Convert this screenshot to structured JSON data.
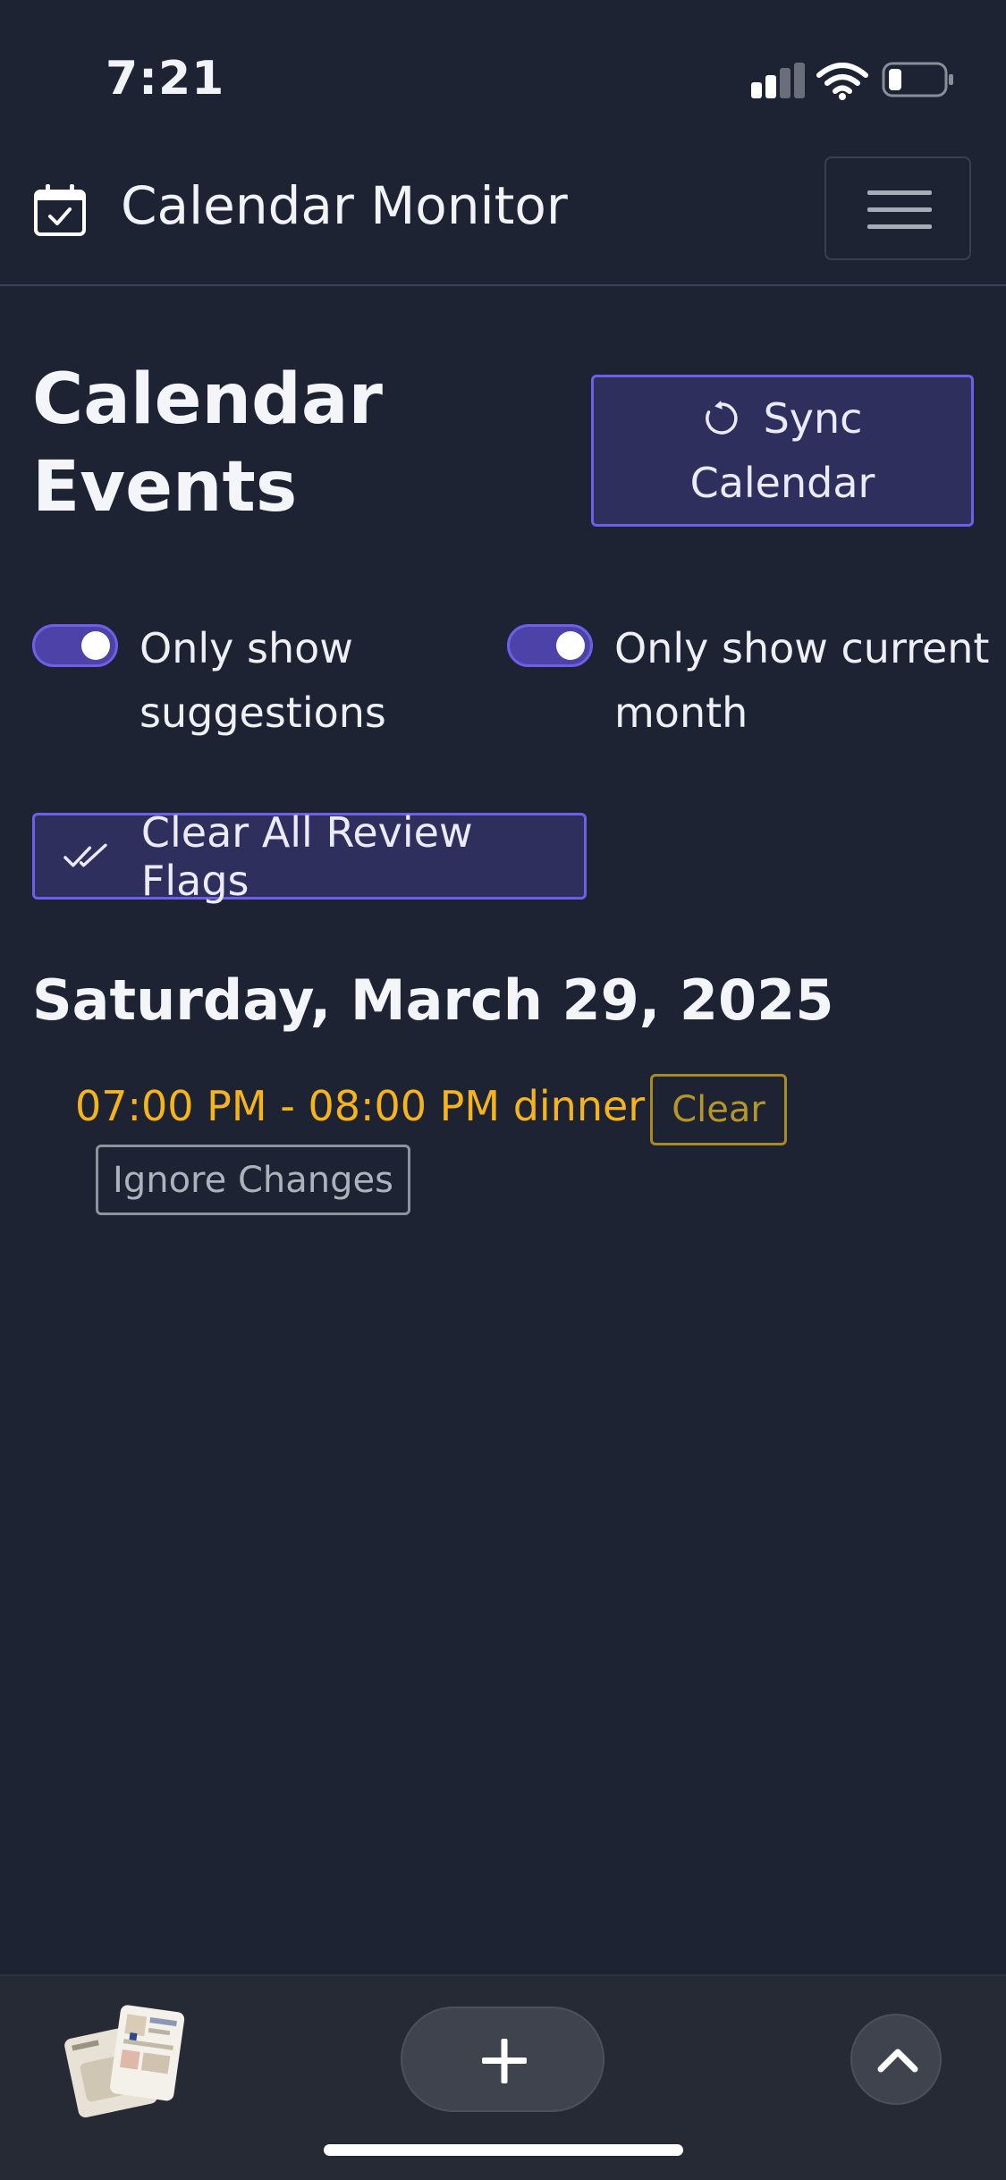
{
  "status_bar": {
    "time": "7:21"
  },
  "header": {
    "title": "Calendar Monitor",
    "icon": "calendar-check-icon",
    "menu_icon": "hamburger-icon"
  },
  "page": {
    "title": "Calendar Events",
    "sync_button": {
      "line1": "Sync",
      "line2": "Calendar",
      "icon": "refresh-icon"
    }
  },
  "filters": {
    "suggestions": {
      "line1": "Only show",
      "line2": "suggestions",
      "enabled": true
    },
    "current_month": {
      "line1": "Only show current",
      "line2": "month",
      "enabled": true
    }
  },
  "clear_flags_button": {
    "label": "Clear All Review Flags",
    "icon": "double-check-icon"
  },
  "days": [
    {
      "date": "Saturday, March 29, 2025",
      "events": [
        {
          "text": "07:00 PM - 08:00 PM dinner",
          "clear_label": "Clear",
          "ignore_label": "Ignore Changes"
        }
      ]
    }
  ],
  "colors": {
    "background": "#1e2333",
    "accent": "#6f5fe8",
    "event_highlight": "#f5b41c"
  },
  "bottom_bar": {
    "new_tab_icon": "plus-icon",
    "scroll_up_icon": "chevron-up-icon"
  }
}
